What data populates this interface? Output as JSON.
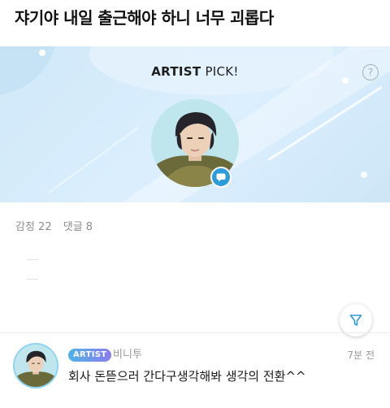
{
  "post": {
    "title": "쟈기야 내일 출근해야 하니 너무 괴롭다"
  },
  "artist_pick": {
    "title_bold": "ARTIST",
    "title_rest": " PICK!",
    "help_label": "?"
  },
  "stats": {
    "emotion": "감정 22",
    "comments": "댓글 8"
  },
  "comment": {
    "badge": "ARTIST",
    "author": "비니투",
    "time": "7분 전",
    "text": "회사 돈뜯으러 간다구생각해봐 생각의 전환^^"
  },
  "colors": {
    "banner_bg": "#d5ecfa",
    "accent_blue": "#2d9cdb",
    "badge_gradient_start": "#4fb3e8",
    "badge_gradient_end": "#8a7cf0"
  },
  "icons": {
    "help": "question-circle-icon",
    "chat": "chat-bubble-icon",
    "filter": "funnel-icon"
  }
}
